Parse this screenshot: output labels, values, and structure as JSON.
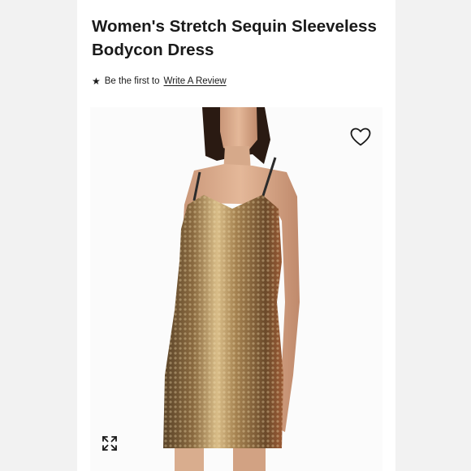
{
  "product": {
    "breadcrumb_partial": "· · ·",
    "title": "Women's Stretch Sequin Sleeveless Bodycon Dress",
    "review_prompt": "Be the first to",
    "review_link": "Write A Review"
  },
  "icons": {
    "star": "star-icon",
    "wishlist": "heart-icon",
    "expand": "expand-icon"
  },
  "colors": {
    "page_bg": "#ffffff",
    "text": "#1a1a1a",
    "sequin_gold": "#b8955c"
  }
}
